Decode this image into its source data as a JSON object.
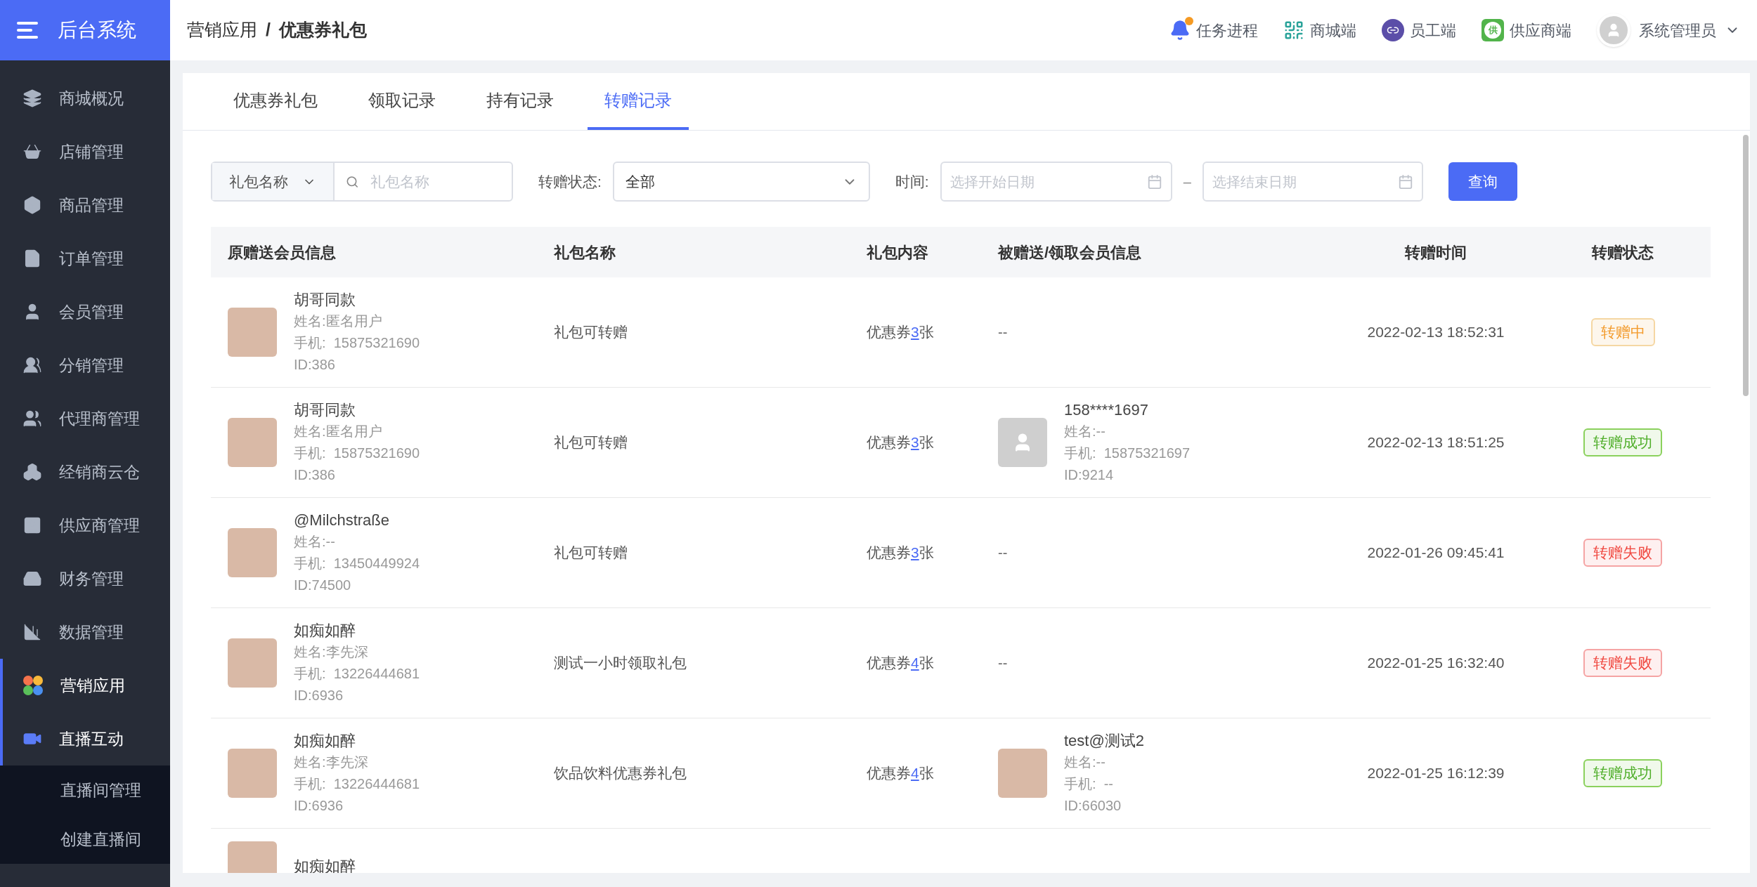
{
  "sidebar": {
    "logo": "后台系统",
    "items": [
      {
        "label": "商城概况",
        "selected": false,
        "expanded": false
      },
      {
        "label": "店铺管理",
        "selected": false,
        "expanded": false
      },
      {
        "label": "商品管理",
        "selected": false,
        "expanded": false
      },
      {
        "label": "订单管理",
        "selected": false,
        "expanded": false
      },
      {
        "label": "会员管理",
        "selected": false,
        "expanded": false
      },
      {
        "label": "分销管理",
        "selected": false,
        "expanded": false
      },
      {
        "label": "代理商管理",
        "selected": false,
        "expanded": false
      },
      {
        "label": "经销商云仓",
        "selected": false,
        "expanded": false
      },
      {
        "label": "供应商管理",
        "selected": false,
        "expanded": false
      },
      {
        "label": "财务管理",
        "selected": false,
        "expanded": false
      },
      {
        "label": "数据管理",
        "selected": false,
        "expanded": false
      },
      {
        "label": "营销应用",
        "selected": true,
        "expanded": false
      },
      {
        "label": "直播互动",
        "selected": true,
        "expanded": true,
        "children": [
          {
            "label": "直播间管理"
          },
          {
            "label": "创建直播间"
          }
        ]
      }
    ]
  },
  "header": {
    "breadcrumb": [
      "营销应用",
      "优惠券礼包"
    ],
    "separator": "/",
    "links": [
      {
        "kind": "bell",
        "label": "任务进程",
        "dot": true
      },
      {
        "kind": "qr",
        "label": "商城端"
      },
      {
        "kind": "staff",
        "label": "员工端"
      },
      {
        "kind": "supplier",
        "label": "供应商端",
        "icon_char": "供"
      }
    ],
    "user": "系统管理员"
  },
  "tabs": [
    {
      "label": "优惠券礼包",
      "selected": false
    },
    {
      "label": "领取记录",
      "selected": false
    },
    {
      "label": "持有记录",
      "selected": false
    },
    {
      "label": "转赠记录",
      "selected": true
    }
  ],
  "filters": {
    "name_select": "礼包名称",
    "name_placeholder": "礼包名称",
    "status_label": "转赠状态:",
    "status_value": "全部",
    "time_label": "时间:",
    "start_placeholder": "选择开始日期",
    "range_separator": "–",
    "end_placeholder": "选择结束日期",
    "query_button": "查询"
  },
  "table": {
    "columns": [
      "原赠送会员信息",
      "礼包名称",
      "礼包内容",
      "被赠送/领取会员信息",
      "转赠时间",
      "转赠状态"
    ],
    "rows": [
      {
        "sender": {
          "avatar": {
            "kind": "photo"
          },
          "nickname": "胡哥同款",
          "name": "姓名:匿名用户",
          "phone": "手机:  15875321690",
          "id": "ID:386"
        },
        "package": "礼包可转赠",
        "content": {
          "prefix": "优惠券",
          "count": "3",
          "suffix": "张"
        },
        "receiver": {
          "kind": "empty",
          "text": "--"
        },
        "time": "2022-02-13 18:52:31",
        "status": {
          "kind": "pending",
          "label": "转赠中"
        }
      },
      {
        "sender": {
          "avatar": {
            "kind": "photo"
          },
          "nickname": "胡哥同款",
          "name": "姓名:匿名用户",
          "phone": "手机:  15875321690",
          "id": "ID:386"
        },
        "package": "礼包可转赠",
        "content": {
          "prefix": "优惠券",
          "count": "3",
          "suffix": "张"
        },
        "receiver": {
          "kind": "member",
          "avatar": {
            "kind": "default"
          },
          "nickname": "158****1697",
          "name": "姓名:--",
          "phone": "手机:  15875321697",
          "id": "ID:9214"
        },
        "time": "2022-02-13 18:51:25",
        "status": {
          "kind": "success",
          "label": "转赠成功"
        }
      },
      {
        "sender": {
          "avatar": {
            "kind": "photo"
          },
          "nickname": "@Milchstraße",
          "name": "姓名:--",
          "phone": "手机:  13450449924",
          "id": "ID:74500"
        },
        "package": "礼包可转赠",
        "content": {
          "prefix": "优惠券",
          "count": "3",
          "suffix": "张"
        },
        "receiver": {
          "kind": "empty",
          "text": "--"
        },
        "time": "2022-01-26 09:45:41",
        "status": {
          "kind": "failed",
          "label": "转赠失败"
        }
      },
      {
        "sender": {
          "avatar": {
            "kind": "photo"
          },
          "nickname": "如痴如醉",
          "name": "姓名:李先深",
          "phone": "手机:  13226444681",
          "id": "ID:6936"
        },
        "package": "测试一小时领取礼包",
        "content": {
          "prefix": "优惠券",
          "count": "4",
          "suffix": "张"
        },
        "receiver": {
          "kind": "empty",
          "text": "--"
        },
        "time": "2022-01-25 16:32:40",
        "status": {
          "kind": "failed",
          "label": "转赠失败"
        }
      },
      {
        "sender": {
          "avatar": {
            "kind": "photo"
          },
          "nickname": "如痴如醉",
          "name": "姓名:李先深",
          "phone": "手机:  13226444681",
          "id": "ID:6936"
        },
        "package": "饮品饮料优惠券礼包",
        "content": {
          "prefix": "优惠券",
          "count": "4",
          "suffix": "张"
        },
        "receiver": {
          "kind": "member",
          "avatar": {
            "kind": "photo"
          },
          "nickname": "test@测试2",
          "name": "姓名:--",
          "phone": "手机:  --",
          "id": "ID:66030"
        },
        "time": "2022-01-25 16:12:39",
        "status": {
          "kind": "success",
          "label": "转赠成功"
        }
      },
      {
        "sender": {
          "avatar": {
            "kind": "photo"
          },
          "nickname": "如痴如醉"
        }
      }
    ]
  }
}
